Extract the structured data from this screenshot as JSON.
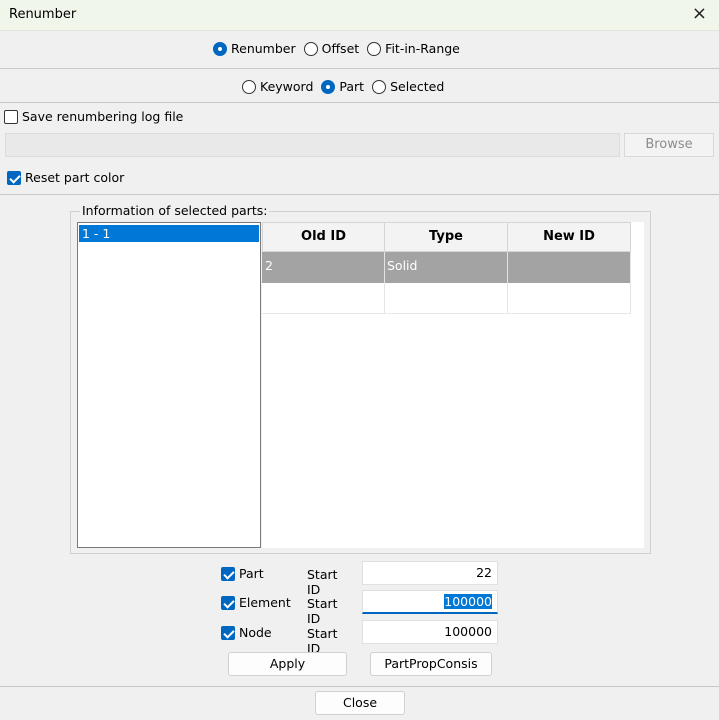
{
  "window": {
    "title": "Renumber",
    "close_glyph": "×"
  },
  "mode": {
    "options": [
      "Renumber",
      "Offset",
      "Fit-in-Range"
    ],
    "selected": "Renumber"
  },
  "scope": {
    "options": [
      "Keyword",
      "Part",
      "Selected"
    ],
    "selected": "Part"
  },
  "save_log": {
    "label": "Save renumbering log file",
    "checked": false
  },
  "log_path": {
    "value": ""
  },
  "browse_label": "Browse",
  "reset_color": {
    "label": "Reset part color",
    "checked": true
  },
  "info": {
    "title": "Information of selected parts:",
    "list_items": [
      "1 - 1"
    ],
    "columns": [
      "Old ID",
      "Type",
      "New ID"
    ],
    "rows": [
      {
        "old_id": "2",
        "type": "Solid",
        "new_id": ""
      }
    ]
  },
  "ids": {
    "start_label": "Start ID",
    "part": {
      "label": "Part",
      "checked": true,
      "value": "22"
    },
    "element": {
      "label": "Element",
      "checked": true,
      "value": "100000"
    },
    "node": {
      "label": "Node",
      "checked": true,
      "value": "100000"
    }
  },
  "buttons": {
    "apply": "Apply",
    "partprop": "PartPropConsis",
    "close": "Close"
  },
  "colors": {
    "accent": "#0067c0",
    "selection": "#0078d7",
    "title_bg": "#f1f6eb",
    "row_selected": "#a3a3a3"
  }
}
